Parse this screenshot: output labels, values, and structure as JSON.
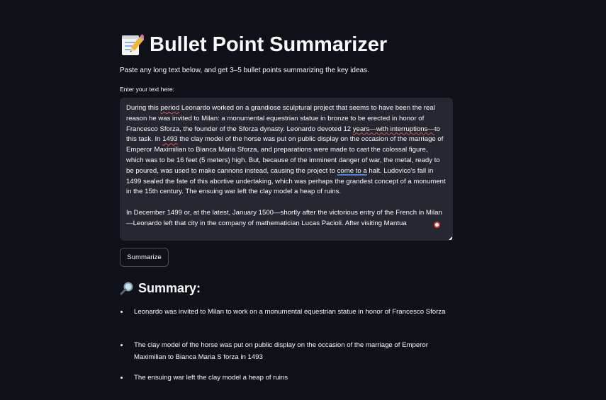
{
  "header": {
    "title": "Bullet Point Summarizer",
    "title_icon": "memo-icon",
    "intro": "Paste any long text below, and get 3–5 bullet points summarizing the key ideas."
  },
  "input": {
    "label": "Enter your text here:",
    "paragraph1": {
      "s1": "During this ",
      "w1": "period",
      "s2": " Leonardo worked on a grandiose sculptural project that seems to have been the real reason he was invited to Milan: a monumental equestrian statue in bronze to be erected in honor of Francesco Sforza, the founder of the Sforza dynasty. Leonardo devoted 12 ",
      "w2": "years—with interruptions—",
      "s3": "to this task. In ",
      "w3": "1493",
      "s4": " the clay model of the horse was put on public display on the occasion of the marriage of Emperor Maximilian to Bianca Maria Sforza, and preparations were made to cast the colossal figure, which was to be 16 feet (5 meters) high. But, because of the imminent danger of war, the metal, ready to be poured, was used to make cannons instead, causing the project to ",
      "w4": "come to a",
      "s5": " halt. Ludovico's fall in 1499 sealed the fate of this abortive undertaking, which was perhaps the grandest concept of a monument in the 15th century. The ensuing war left the clay model a heap of ruins."
    },
    "paragraph2": "In December 1499 or, at the latest, January 1500—shortly after the victorious entry of the French in Milan—Leonardo left that city in the company of mathematician Lucas Pacioli. After visiting Mantua"
  },
  "actions": {
    "summarize_label": "Summarize"
  },
  "summary": {
    "heading": "Summary:",
    "heading_icon": "magnifying-glass-icon",
    "bullets": [
      "Leonardo was invited to Milan to work on a monumental equestrian statue in honor of Francesco Sforza",
      "The clay model of the horse was put on public display on the occasion of the marriage of Emperor Maximilian to Bianca Maria S forza in 1493",
      "The ensuing war left the clay model a heap of ruins"
    ]
  },
  "colors": {
    "background": "#0e1117",
    "text": "#fafafa",
    "input_background": "#262730",
    "spellcheck_red": "#e0524a",
    "spellcheck_blue": "#4a7fd4"
  }
}
